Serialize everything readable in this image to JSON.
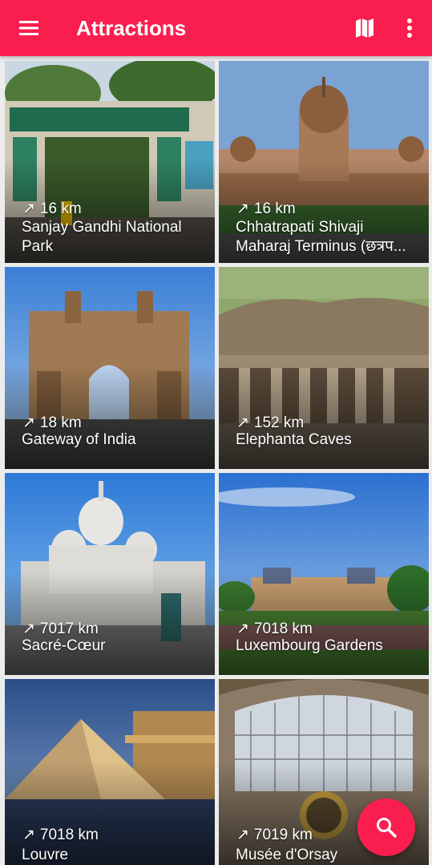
{
  "appbar": {
    "title": "Attractions",
    "menu_icon": "menu-icon",
    "map_icon": "map-icon",
    "more_icon": "more-vert-icon",
    "color": "#f91e4e"
  },
  "attractions": [
    {
      "distance": "16 km",
      "name": "Sanjay Gandhi National Park"
    },
    {
      "distance": "16 km",
      "name": "Chhatrapati Shivaji Maharaj Terminus (छत्रप..."
    },
    {
      "distance": "18 km",
      "name": "Gateway of India"
    },
    {
      "distance": "152 km",
      "name": "Elephanta Caves"
    },
    {
      "distance": "7017 km",
      "name": "Sacré-Cœur"
    },
    {
      "distance": "7018 km",
      "name": "Luxembourg Gardens"
    },
    {
      "distance": "7018 km",
      "name": "Louvre"
    },
    {
      "distance": "7019 km",
      "name": "Musée d'Orsay"
    }
  ],
  "fab": {
    "icon": "search-icon"
  }
}
